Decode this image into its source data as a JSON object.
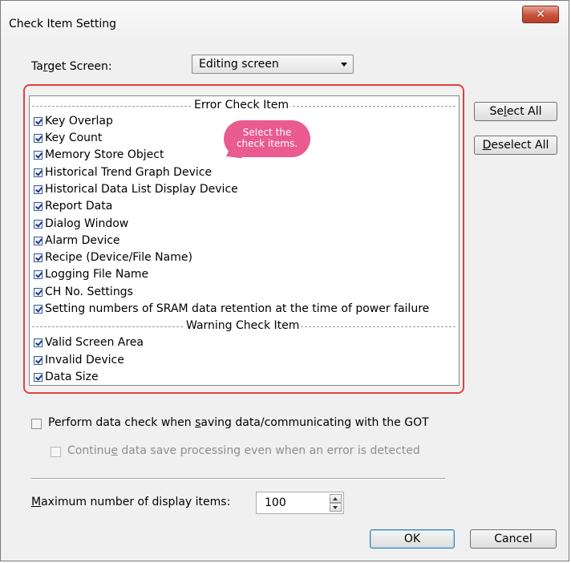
{
  "window": {
    "title": "Check Item Setting"
  },
  "target": {
    "label_pre": "Ta",
    "label_key": "r",
    "label_post": "get Screen:",
    "value": "Editing screen"
  },
  "error_section": {
    "label": "Error Check Item"
  },
  "error_items": [
    "Key Overlap",
    "Key Count",
    "Memory Store Object",
    "Historical Trend Graph Device",
    "Historical Data List Display Device",
    "Report Data",
    "Dialog Window",
    "Alarm Device",
    "Recipe (Device/File Name)",
    "Logging File Name",
    "CH No. Settings",
    "Setting numbers of SRAM data retention at the time of power failure"
  ],
  "warning_section": {
    "label": "Warning Check Item"
  },
  "warning_items": [
    "Valid Screen Area",
    "Invalid Device",
    "Data Size"
  ],
  "callout": {
    "line1": "Select the",
    "line2": "check items."
  },
  "buttons": {
    "select_all": {
      "pre": "Se",
      "key": "l",
      "post": "ect All"
    },
    "deselect_all": {
      "pre": "",
      "key": "D",
      "post": "eselect All"
    },
    "ok": "OK",
    "cancel": "Cancel"
  },
  "options": {
    "perform_check": {
      "pre": "Perform data check when ",
      "key": "s",
      "post": "aving data/communicating with the GOT",
      "checked": false
    },
    "continue_save": {
      "pre": "Continu",
      "key": "e",
      "post": " data save processing even when an error is detected",
      "checked": false,
      "enabled": false
    }
  },
  "max_display": {
    "pre": "",
    "key": "M",
    "post": "aximum number of display items:",
    "value": "100"
  },
  "colors": {
    "highlight_frame": "#e1413f",
    "callout": "#ea5b8f",
    "close_button": "#c7513b"
  }
}
